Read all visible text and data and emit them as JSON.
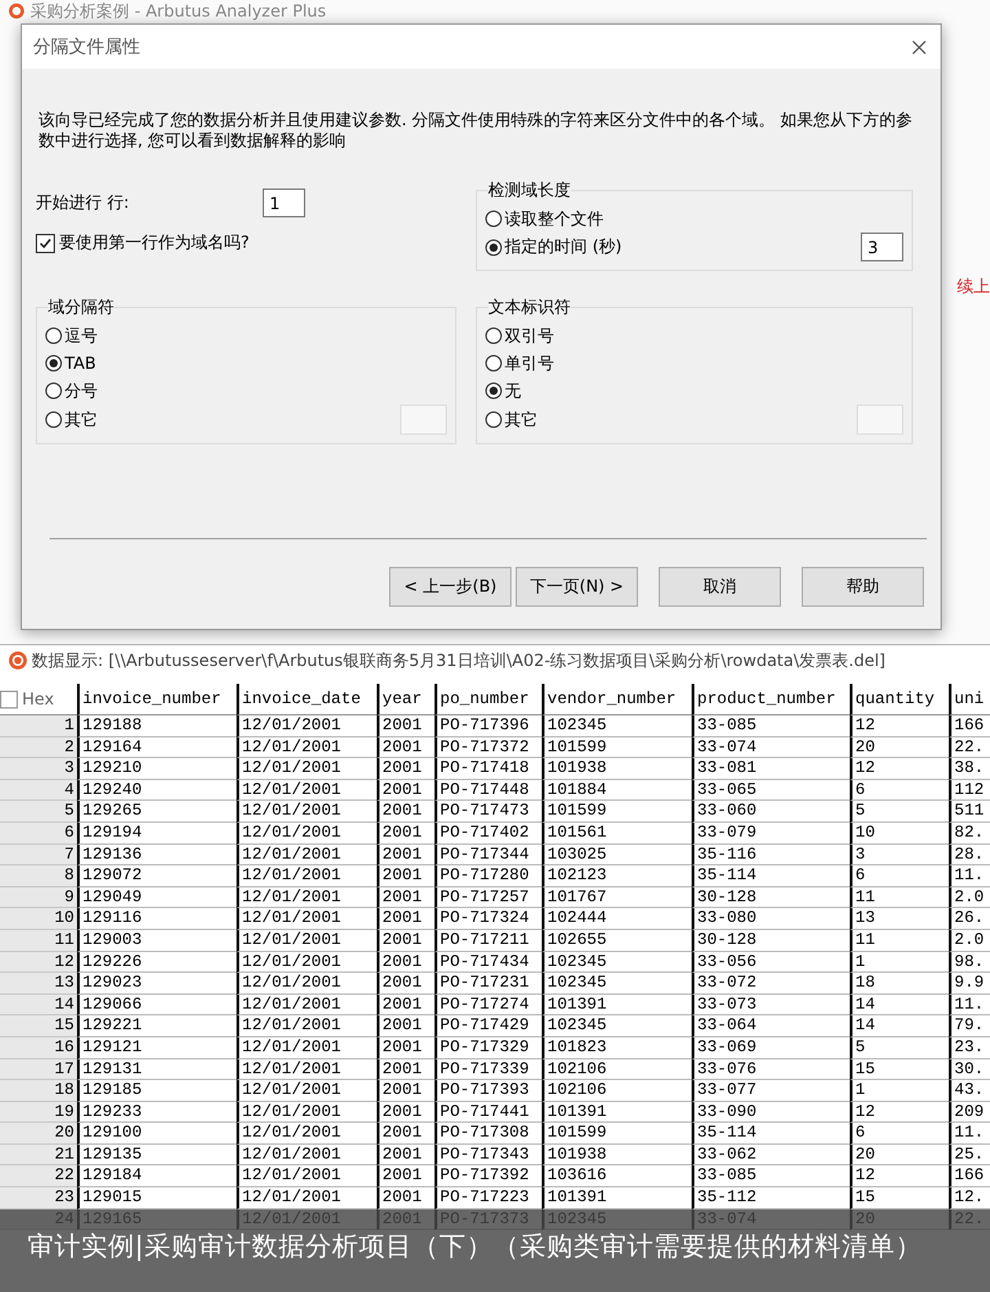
{
  "app_window": {
    "title": "采购分析案例 - Arbutus Analyzer Plus",
    "side_note": "续上"
  },
  "dialog": {
    "title": "分隔文件属性",
    "intro": "该向导已经完成了您的数据分析并且使用建议参数. 分隔文件使用特殊的字符来区分文件中的各个域。 如果您从下方的参数中进行选择, 您可以看到数据解释的影响",
    "start_line": {
      "label": "开始进行 行:",
      "value": "1"
    },
    "header_checkbox": {
      "label": "要使用第一行作为域名吗?",
      "checked": true
    },
    "field_length": {
      "title": "检测域长度",
      "options": [
        {
          "label": "读取整个文件",
          "selected": false
        },
        {
          "label": "指定的时间 (秒)",
          "selected": true
        }
      ],
      "seconds": "3"
    },
    "field_separator": {
      "title": "域分隔符",
      "options": [
        {
          "label": "逗号",
          "selected": false
        },
        {
          "label": "TAB",
          "selected": true
        },
        {
          "label": "分号",
          "selected": false
        },
        {
          "label": "其它",
          "selected": false
        }
      ]
    },
    "text_qualifier": {
      "title": "文本标识符",
      "options": [
        {
          "label": "双引号",
          "selected": false
        },
        {
          "label": "单引号",
          "selected": false
        },
        {
          "label": "无",
          "selected": true
        },
        {
          "label": "其它",
          "selected": false
        }
      ]
    },
    "buttons": [
      "< 上一步(B)",
      "下一页(N) >",
      "取消",
      "帮助"
    ]
  },
  "data_view": {
    "title": "数据显示: [\\\\Arbutusseserver\\f\\Arbutus银联商务5月31日培训\\A02-练习数据项目\\采购分析\\rowdata\\发票表.del]",
    "hex": {
      "label": "Hex",
      "checked": false
    },
    "columns": [
      "invoice_number",
      "invoice_date",
      "year",
      "po_number",
      "vendor_number",
      "product_number",
      "quantity",
      "uni"
    ],
    "rows": [
      {
        "row_number": "1",
        "cells": [
          "129188",
          "12/01/2001",
          "2001",
          "PO-717396",
          "102345",
          "33-085",
          "12",
          "166"
        ]
      },
      {
        "row_number": "2",
        "cells": [
          "129164",
          "12/01/2001",
          "2001",
          "PO-717372",
          "101599",
          "33-074",
          "20",
          "22."
        ]
      },
      {
        "row_number": "3",
        "cells": [
          "129210",
          "12/01/2001",
          "2001",
          "PO-717418",
          "101938",
          "33-081",
          "12",
          "38."
        ]
      },
      {
        "row_number": "4",
        "cells": [
          "129240",
          "12/01/2001",
          "2001",
          "PO-717448",
          "101884",
          "33-065",
          "6",
          "112"
        ]
      },
      {
        "row_number": "5",
        "cells": [
          "129265",
          "12/01/2001",
          "2001",
          "PO-717473",
          "101599",
          "33-060",
          "5",
          "511"
        ]
      },
      {
        "row_number": "6",
        "cells": [
          "129194",
          "12/01/2001",
          "2001",
          "PO-717402",
          "101561",
          "33-079",
          "10",
          "82."
        ]
      },
      {
        "row_number": "7",
        "cells": [
          "129136",
          "12/01/2001",
          "2001",
          "PO-717344",
          "103025",
          "35-116",
          "3",
          "28."
        ]
      },
      {
        "row_number": "8",
        "cells": [
          "129072",
          "12/01/2001",
          "2001",
          "PO-717280",
          "102123",
          "35-114",
          "6",
          "11."
        ]
      },
      {
        "row_number": "9",
        "cells": [
          "129049",
          "12/01/2001",
          "2001",
          "PO-717257",
          "101767",
          "30-128",
          "11",
          "2.0"
        ]
      },
      {
        "row_number": "10",
        "cells": [
          "129116",
          "12/01/2001",
          "2001",
          "PO-717324",
          "102444",
          "33-080",
          "13",
          "26."
        ]
      },
      {
        "row_number": "11",
        "cells": [
          "129003",
          "12/01/2001",
          "2001",
          "PO-717211",
          "102655",
          "30-128",
          "11",
          "2.0"
        ]
      },
      {
        "row_number": "12",
        "cells": [
          "129226",
          "12/01/2001",
          "2001",
          "PO-717434",
          "102345",
          "33-056",
          "1",
          "98."
        ]
      },
      {
        "row_number": "13",
        "cells": [
          "129023",
          "12/01/2001",
          "2001",
          "PO-717231",
          "102345",
          "33-072",
          "18",
          "9.9"
        ]
      },
      {
        "row_number": "14",
        "cells": [
          "129066",
          "12/01/2001",
          "2001",
          "PO-717274",
          "101391",
          "33-073",
          "14",
          "11."
        ]
      },
      {
        "row_number": "15",
        "cells": [
          "129221",
          "12/01/2001",
          "2001",
          "PO-717429",
          "102345",
          "33-064",
          "14",
          "79."
        ]
      },
      {
        "row_number": "16",
        "cells": [
          "129121",
          "12/01/2001",
          "2001",
          "PO-717329",
          "101823",
          "33-069",
          "5",
          "23."
        ]
      },
      {
        "row_number": "17",
        "cells": [
          "129131",
          "12/01/2001",
          "2001",
          "PO-717339",
          "102106",
          "33-076",
          "15",
          "30."
        ]
      },
      {
        "row_number": "18",
        "cells": [
          "129185",
          "12/01/2001",
          "2001",
          "PO-717393",
          "102106",
          "33-077",
          "1",
          "43."
        ]
      },
      {
        "row_number": "19",
        "cells": [
          "129233",
          "12/01/2001",
          "2001",
          "PO-717441",
          "101391",
          "33-090",
          "12",
          "209"
        ]
      },
      {
        "row_number": "20",
        "cells": [
          "129100",
          "12/01/2001",
          "2001",
          "PO-717308",
          "101599",
          "35-114",
          "6",
          "11."
        ]
      },
      {
        "row_number": "21",
        "cells": [
          "129135",
          "12/01/2001",
          "2001",
          "PO-717343",
          "101938",
          "33-062",
          "20",
          "25."
        ]
      },
      {
        "row_number": "22",
        "cells": [
          "129184",
          "12/01/2001",
          "2001",
          "PO-717392",
          "103616",
          "33-085",
          "12",
          "166"
        ]
      },
      {
        "row_number": "23",
        "cells": [
          "129015",
          "12/01/2001",
          "2001",
          "PO-717223",
          "101391",
          "35-112",
          "15",
          "12."
        ]
      },
      {
        "row_number": "24",
        "cells": [
          "129165",
          "12/01/2001",
          "2001",
          "PO-717373",
          "102345",
          "33-074",
          "20",
          "22."
        ]
      }
    ]
  },
  "caption": "审计实例|采购审计数据分析项目（下）（采购类审计需要提供的材料清单）"
}
